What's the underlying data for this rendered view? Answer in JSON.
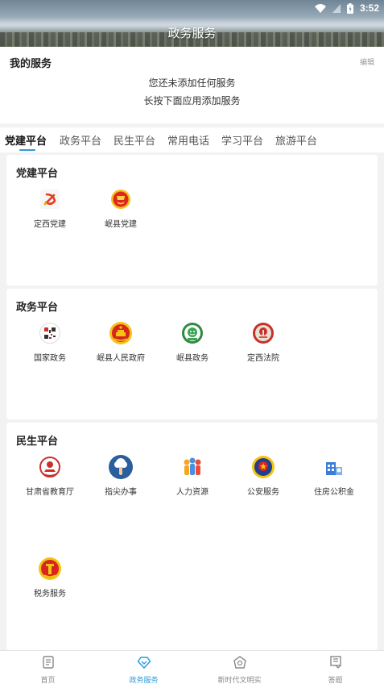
{
  "status": {
    "time": "3:52"
  },
  "header": {
    "title": "政务服务"
  },
  "my_services": {
    "title": "我的服务",
    "edit_label": "编辑",
    "hint_line1": "您还未添加任何服务",
    "hint_line2": "长按下面应用添加服务"
  },
  "tabs": [
    {
      "label": "党建平台",
      "active": true
    },
    {
      "label": "政务平台"
    },
    {
      "label": "民生平台"
    },
    {
      "label": "常用电话"
    },
    {
      "label": "学习平台"
    },
    {
      "label": "旅游平台"
    }
  ],
  "sections": {
    "party": {
      "title": "党建平台",
      "items": [
        {
          "label": "定西党建",
          "icon": "party-emblem-icon"
        },
        {
          "label": "岷县党建",
          "icon": "party-flag-icon"
        }
      ]
    },
    "gov": {
      "title": "政务平台",
      "items": [
        {
          "label": "国家政务",
          "icon": "qr-code-icon"
        },
        {
          "label": "岷县人民政府",
          "icon": "national-emblem-icon"
        },
        {
          "label": "岷县政务",
          "icon": "gov-service-icon"
        },
        {
          "label": "定西法院",
          "icon": "court-emblem-icon"
        }
      ]
    },
    "life": {
      "title": "民生平台",
      "items": [
        {
          "label": "甘肃省教育厅",
          "icon": "education-icon"
        },
        {
          "label": "指尖办事",
          "icon": "fingertip-icon"
        },
        {
          "label": "人力资源",
          "icon": "human-resources-icon"
        },
        {
          "label": "公安服务",
          "icon": "police-emblem-icon"
        },
        {
          "label": "住房公积金",
          "icon": "housing-fund-icon"
        },
        {
          "label": "税务服务",
          "icon": "tax-emblem-icon"
        }
      ]
    }
  },
  "bottom_nav": [
    {
      "label": "首页",
      "icon": "home-icon"
    },
    {
      "label": "政务服务",
      "icon": "gov-service-nav-icon",
      "active": true
    },
    {
      "label": "新时代文明实",
      "icon": "civilization-icon"
    },
    {
      "label": "答题",
      "icon": "quiz-icon"
    }
  ],
  "colors": {
    "accent": "#2d9cdb",
    "party_red": "#d7261f",
    "gold": "#f5c518"
  }
}
